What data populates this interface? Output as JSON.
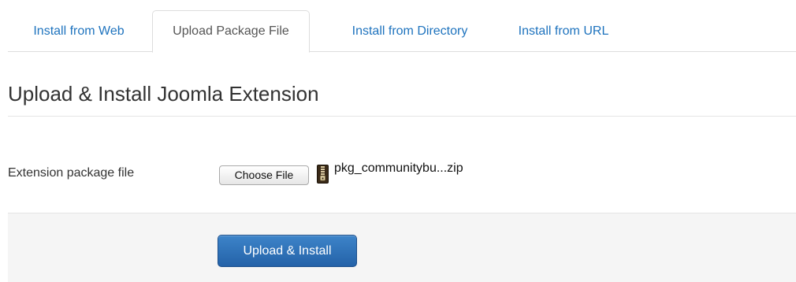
{
  "tabs": [
    {
      "label": "Install from Web",
      "active": false
    },
    {
      "label": "Upload Package File",
      "active": true
    },
    {
      "label": "Install from Directory",
      "active": false
    },
    {
      "label": "Install from URL",
      "active": false
    }
  ],
  "page": {
    "heading": "Upload & Install Joomla Extension"
  },
  "form": {
    "field_label": "Extension package file",
    "choose_button": "Choose File",
    "file_icon": "zip-file-icon",
    "file_name": "pkg_communitybu...zip"
  },
  "actions": {
    "install_button": "Upload & Install"
  },
  "colors": {
    "link": "#1e73be",
    "primary_button": "#2462a8",
    "actions_background": "#f5f5f5"
  }
}
